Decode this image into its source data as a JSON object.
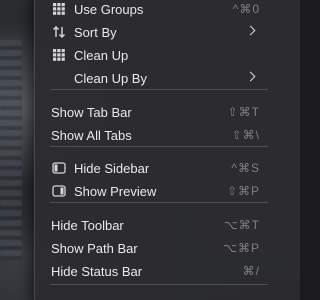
{
  "menu": {
    "groups": [
      {
        "items": [
          {
            "label": "Use Groups",
            "icon": "grid-icon",
            "shortcut": "^⌘0"
          },
          {
            "label": "Sort By",
            "icon": "sort-arrows-icon",
            "submenu": true
          },
          {
            "label": "Clean Up",
            "icon": "grid-icon"
          },
          {
            "label": "Clean Up By",
            "submenu": true
          }
        ]
      },
      {
        "items": [
          {
            "label": "Show Tab Bar",
            "shortcut": "⇧⌘T"
          },
          {
            "label": "Show All Tabs",
            "shortcut": "⇧⌘\\"
          }
        ]
      },
      {
        "items": [
          {
            "label": "Hide Sidebar",
            "icon": "sidebar-icon",
            "shortcut": "^⌘S"
          },
          {
            "label": "Show Preview",
            "icon": "preview-icon",
            "shortcut": "⇧⌘P"
          }
        ]
      },
      {
        "items": [
          {
            "label": "Hide Toolbar",
            "shortcut": "⌥⌘T"
          },
          {
            "label": "Show Path Bar",
            "shortcut": "⌥⌘P"
          },
          {
            "label": "Hide Status Bar",
            "shortcut": "⌘/"
          }
        ]
      }
    ]
  },
  "colors": {
    "menu_bg": "#2c2c2f",
    "text": "#e9e9ea",
    "shortcut": "#7f7f84",
    "separator": "#505054"
  }
}
